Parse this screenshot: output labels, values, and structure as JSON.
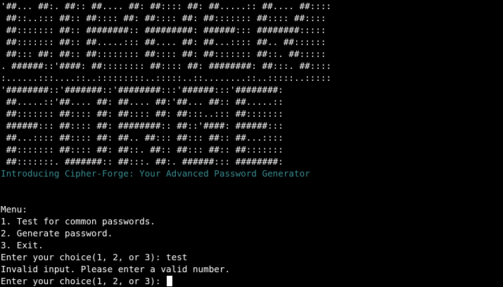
{
  "terminal": {
    "banner": [
      "'##... ##:. ##:: ##.... ##: ##:::: ##: ##.....:: ##.... ##::::",
      " ##::..::: ##:: ##:::: ##: ##:::: ##: ##::::::: ##:::: ##::::",
      " ##::::::: ##:: ########:: #########: ######::: ########:::::",
      " ##::::::: ##:: ##.....::: ##.... ##: ##...:::: ##.. ##::::::",
      " ##::: ##: ##:: ##:::::::: ##:::: ##: ##::::::: ##::. ##:::::",
      ". ######::'####: ##:::::::: ##:::: ##: ########: ##:::. ##::::",
      ":......:::....::..:::::::::..:::::..::........::..:::::..:::::",
      "'########::'#######::'########:::'######:::'########:",
      " ##.....::'##.... ##: ##.... ##:'##... ##:: ##.....::",
      " ##::::::: ##:::: ##: ##:::: ##: ##:::..::: ##:::::::",
      " ######::: ##:::: ##: ########:: ##::'####: ######:::",
      " ##...:::: ##:::: ##: ##.. ##::: ##::: ##:: ##...::::",
      " ##::::::: ##:::: ##: ##::. ##:: ##::: ##:: ##:::::::",
      " ##:::::::. #######:: ##:::. ##:. ######::: ########:"
    ],
    "intro": "Introducing Cipher-Forge: Your Advanced Password Generator",
    "menu_title": "Menu:",
    "menu_items": [
      "1. Test for common passwords.",
      "2. Generate password.",
      "3. Exit."
    ],
    "first_prompt": "Enter your choice(1, 2, or 3): test",
    "error_message": "Invalid input. Please enter a valid number.",
    "second_prompt": "Enter your choice(1, 2, or 3): "
  },
  "colors": {
    "background": "#000000",
    "text": "#ffffff",
    "intro": "#3a8c91"
  }
}
